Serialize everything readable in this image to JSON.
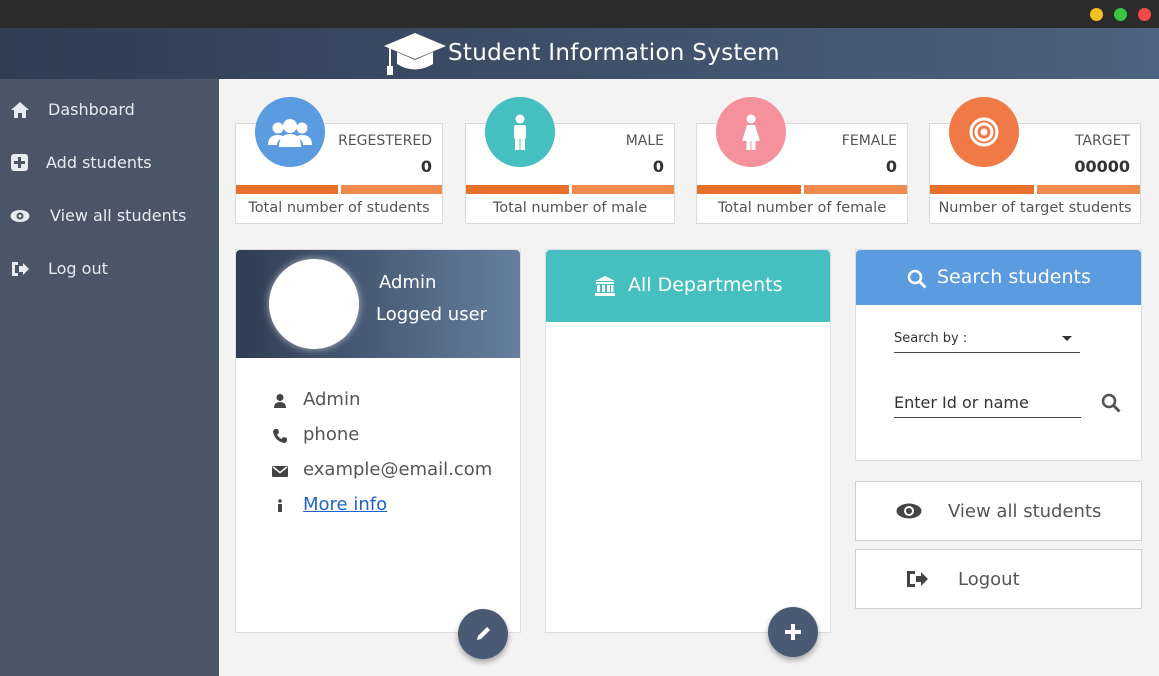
{
  "app": {
    "title": "Student Information System"
  },
  "sidebar": {
    "items": [
      {
        "label": "Dashboard",
        "icon": "home-icon"
      },
      {
        "label": "Add students",
        "icon": "plus-square-icon"
      },
      {
        "label": "View all students",
        "icon": "eye-icon"
      },
      {
        "label": "Log out",
        "icon": "sign-out-icon"
      }
    ]
  },
  "stats": [
    {
      "caption": "REGESTERED",
      "value": "0",
      "footer": "Total  number of students",
      "color": "#5b9be0",
      "icon": "users-icon"
    },
    {
      "caption": "MALE",
      "value": "0",
      "footer": "Total  number of male",
      "color": "#45bfbf",
      "icon": "male-icon"
    },
    {
      "caption": "FEMALE",
      "value": "0",
      "footer": "Total  number of female",
      "color": "#f5919c",
      "icon": "female-icon"
    },
    {
      "caption": "TARGET",
      "value": "00000",
      "footer": "Number of target students",
      "color": "#ef7a45",
      "icon": "target-icon"
    }
  ],
  "profile": {
    "name": "Admin",
    "role": "Logged user",
    "rows": [
      {
        "text": "Admin",
        "icon": "user-icon"
      },
      {
        "text": "phone",
        "icon": "phone-icon"
      },
      {
        "text": "example@email.com",
        "icon": "envelope-icon"
      },
      {
        "text": "More info",
        "icon": "info-icon"
      }
    ]
  },
  "departments": {
    "title": "All Departments"
  },
  "search": {
    "title": "Search students",
    "search_by_label": "Search by :",
    "placeholder": "Enter Id or name"
  },
  "actions": {
    "view_all": "View all students",
    "logout": "Logout"
  },
  "colors": {
    "sidebar": "#4a5568",
    "header": "#2f3c52",
    "bar_dark": "#e8702d",
    "bar_light": "#ef8a4f",
    "link": "#1e64c8"
  }
}
